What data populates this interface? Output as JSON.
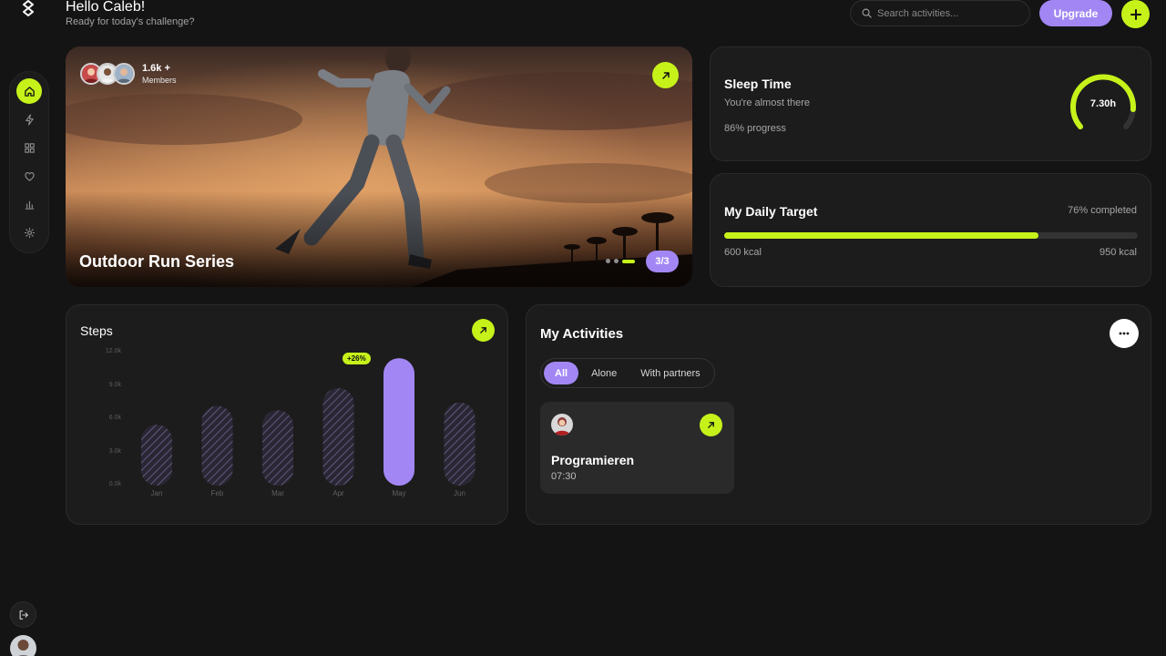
{
  "header": {
    "greeting": "Hello Caleb!",
    "subtitle": "Ready for today's challenge?",
    "search_placeholder": "Search activities...",
    "upgrade_label": "Upgrade"
  },
  "sidebar": {
    "items": [
      {
        "name": "home",
        "icon": "home-icon",
        "active": true
      },
      {
        "name": "activity",
        "icon": "lightning-icon",
        "active": false
      },
      {
        "name": "dashboard",
        "icon": "grid-icon",
        "active": false
      },
      {
        "name": "favorites",
        "icon": "heart-icon",
        "active": false
      },
      {
        "name": "stats",
        "icon": "bar-chart-icon",
        "active": false
      },
      {
        "name": "settings",
        "icon": "gear-icon",
        "active": false
      }
    ]
  },
  "hero": {
    "members_count": "1.6k +",
    "members_label": "Members",
    "title": "Outdoor Run Series",
    "pager": "3/3",
    "slide_index": 3,
    "slide_total": 3
  },
  "sleep": {
    "title": "Sleep Time",
    "subtitle": "You're almost there",
    "progress_text": "86% progress",
    "progress": 0.86,
    "value": "7.30h"
  },
  "target": {
    "title": "My Daily Target",
    "completed_text": "76% completed",
    "progress": 0.76,
    "current": "600 kcal",
    "goal": "950 kcal"
  },
  "steps": {
    "title": "Steps",
    "badge": "+26%"
  },
  "chart_data": {
    "type": "bar",
    "categories": [
      "Jan",
      "Feb",
      "Mar",
      "Apr",
      "May",
      "Jun"
    ],
    "values": [
      5.5,
      7.2,
      6.8,
      8.8,
      11.5,
      7.5
    ],
    "highlight_index": 4,
    "yticks": [
      "12.0k",
      "9.0k",
      "6.0k",
      "3.0k",
      "0.0k"
    ],
    "ylim": [
      0,
      12
    ],
    "grid": false
  },
  "activities": {
    "title": "My Activities",
    "filters": [
      {
        "label": "All",
        "active": true
      },
      {
        "label": "Alone",
        "active": false
      },
      {
        "label": "With partners",
        "active": false
      }
    ],
    "items": [
      {
        "title": "Programieren",
        "time": "07:30"
      }
    ]
  },
  "colors": {
    "accent_lime": "#c6f21a",
    "accent_purple": "#a287f4",
    "background": "#141414",
    "card": "#1c1c1c"
  }
}
